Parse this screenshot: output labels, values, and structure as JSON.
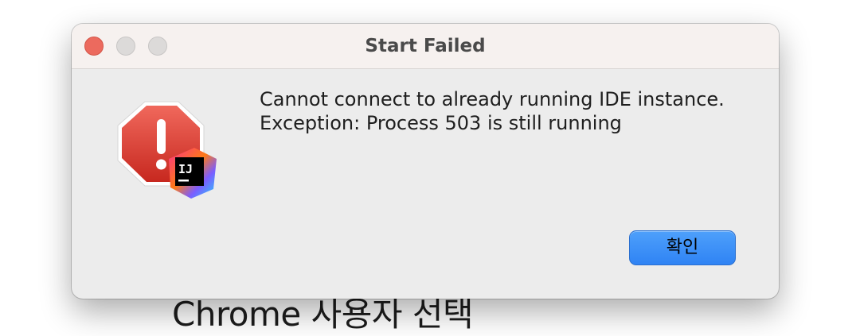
{
  "background": {
    "text": "Chrome 사용자 선택"
  },
  "dialog": {
    "title": "Start Failed",
    "message_lines": [
      "Cannot connect to already running IDE instance.",
      "Exception: Process 503 is still running"
    ],
    "ok_label": "확인",
    "icon_badge_text": "IJ",
    "icon": "error-octagon-icon",
    "badge_icon": "intellij-idea-icon"
  },
  "colors": {
    "accent": "#3b8ff7",
    "close": "#ec6a5e",
    "error": "#d9463b"
  }
}
